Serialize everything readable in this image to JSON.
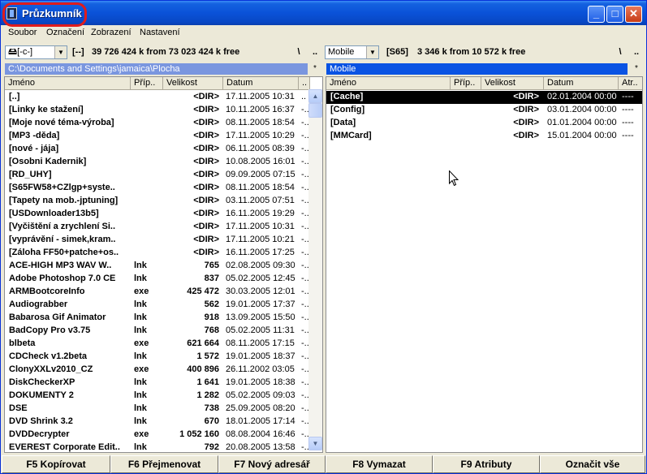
{
  "window": {
    "title": "Průzkumník"
  },
  "menu": [
    "Soubor",
    "Označení",
    "Zobrazení",
    "Nastavení"
  ],
  "left": {
    "drive": "[-c-]",
    "volume": "[--]",
    "space": "39 726 424 k from 73 023 424 k free",
    "root_btn": "\\",
    "up_btn": "..",
    "path": "C:\\Documents and Settings\\jamaica\\Plocha",
    "star": "*",
    "columns": [
      "Jméno",
      "Příp..",
      "Velikost",
      "Datum",
      ".."
    ],
    "rows": [
      {
        "name": "[..]",
        "ext": "",
        "size": "<DIR>",
        "date": "17.11.2005 10:31",
        "attr": ".."
      },
      {
        "name": "[Linky ke stažení]",
        "ext": "",
        "size": "<DIR>",
        "date": "10.11.2005 16:37",
        "attr": "-.."
      },
      {
        "name": "[Moje nové téma-výroba]",
        "ext": "",
        "size": "<DIR>",
        "date": "08.11.2005 18:54",
        "attr": "-.."
      },
      {
        "name": "[MP3 -děda]",
        "ext": "",
        "size": "<DIR>",
        "date": "17.11.2005 10:29",
        "attr": "-.."
      },
      {
        "name": "[nové - jája]",
        "ext": "",
        "size": "<DIR>",
        "date": "06.11.2005 08:39",
        "attr": "-.."
      },
      {
        "name": "[Osobni Kadernik]",
        "ext": "",
        "size": "<DIR>",
        "date": "10.08.2005 16:01",
        "attr": "-.."
      },
      {
        "name": "[RD_UHY]",
        "ext": "",
        "size": "<DIR>",
        "date": "09.09.2005 07:15",
        "attr": "-.."
      },
      {
        "name": "[S65FW58+CZlgp+syste..",
        "ext": "",
        "size": "<DIR>",
        "date": "08.11.2005 18:54",
        "attr": "-.."
      },
      {
        "name": "[Tapety na mob.-jptuning]",
        "ext": "",
        "size": "<DIR>",
        "date": "03.11.2005 07:51",
        "attr": "-.."
      },
      {
        "name": "[USDownloader13b5]",
        "ext": "",
        "size": "<DIR>",
        "date": "16.11.2005 19:29",
        "attr": "-.."
      },
      {
        "name": "[Vyčištění a zrychlení Si..",
        "ext": "",
        "size": "<DIR>",
        "date": "17.11.2005 10:31",
        "attr": "-.."
      },
      {
        "name": "[vyprávění - simek,kram..",
        "ext": "",
        "size": "<DIR>",
        "date": "17.11.2005 10:21",
        "attr": "-.."
      },
      {
        "name": "[Záloha FF50+patche+os..",
        "ext": "",
        "size": "<DIR>",
        "date": "16.11.2005 17:25",
        "attr": "-.."
      },
      {
        "name": "ACE-HIGH MP3 WAV W..",
        "ext": "lnk",
        "size": "765",
        "date": "02.08.2005 09:30",
        "attr": "-.."
      },
      {
        "name": "Adobe Photoshop 7.0 CE",
        "ext": "lnk",
        "size": "837",
        "date": "05.02.2005 12:45",
        "attr": "-.."
      },
      {
        "name": "ARMBootcoreInfo",
        "ext": "exe",
        "size": "425 472",
        "date": "30.03.2005 12:01",
        "attr": "-.."
      },
      {
        "name": "Audiograbber",
        "ext": "lnk",
        "size": "562",
        "date": "19.01.2005 17:37",
        "attr": "-.."
      },
      {
        "name": "Babarosa Gif Animator",
        "ext": "lnk",
        "size": "918",
        "date": "13.09.2005 15:50",
        "attr": "-.."
      },
      {
        "name": "BadCopy Pro v3.75",
        "ext": "lnk",
        "size": "768",
        "date": "05.02.2005 11:31",
        "attr": "-.."
      },
      {
        "name": "blbeta",
        "ext": "exe",
        "size": "621 664",
        "date": "08.11.2005 17:15",
        "attr": "-.."
      },
      {
        "name": "CDCheck v1.2beta",
        "ext": "lnk",
        "size": "1 572",
        "date": "19.01.2005 18:37",
        "attr": "-.."
      },
      {
        "name": "ClonyXXLv2010_CZ",
        "ext": "exe",
        "size": "400 896",
        "date": "26.11.2002 03:05",
        "attr": "-.."
      },
      {
        "name": "DiskCheckerXP",
        "ext": "lnk",
        "size": "1 641",
        "date": "19.01.2005 18:38",
        "attr": "-.."
      },
      {
        "name": "DOKUMENTY 2",
        "ext": "lnk",
        "size": "1 282",
        "date": "05.02.2005 09:03",
        "attr": "-.."
      },
      {
        "name": "DSE",
        "ext": "lnk",
        "size": "738",
        "date": "25.09.2005 08:20",
        "attr": "-.."
      },
      {
        "name": "DVD Shrink 3.2",
        "ext": "lnk",
        "size": "670",
        "date": "18.01.2005 17:14",
        "attr": "-.."
      },
      {
        "name": "DVDDecrypter",
        "ext": "exe",
        "size": "1 052 160",
        "date": "08.08.2004 16:46",
        "attr": "-.."
      },
      {
        "name": "EVEREST Corporate Edit..",
        "ext": "lnk",
        "size": "792",
        "date": "20.08.2005 13:58",
        "attr": "-.."
      }
    ]
  },
  "right": {
    "drive": "Mobile",
    "volume": "[S65]",
    "space": "3 346 k from 10 572 k free",
    "root_btn": "\\",
    "up_btn": "..",
    "path": "Mobile",
    "star": "*",
    "columns": [
      "Jméno",
      "Příp..",
      "Velikost",
      "Datum",
      "Atr.."
    ],
    "rows": [
      {
        "name": "[Cache]",
        "ext": "",
        "size": "<DIR>",
        "date": "02.01.2004 00:00",
        "attr": "----",
        "selected": true
      },
      {
        "name": "[Config]",
        "ext": "",
        "size": "<DIR>",
        "date": "03.01.2004 00:00",
        "attr": "----"
      },
      {
        "name": "[Data]",
        "ext": "",
        "size": "<DIR>",
        "date": "01.01.2004 00:00",
        "attr": "----"
      },
      {
        "name": "[MMCard]",
        "ext": "",
        "size": "<DIR>",
        "date": "15.01.2004 00:00",
        "attr": "----"
      }
    ]
  },
  "fkeys": [
    "F5 Kopírovat",
    "F6 Přejmenovat",
    "F7 Nový adresář",
    "F8 Vymazat",
    "F9 Atributy",
    "Označit vše"
  ]
}
